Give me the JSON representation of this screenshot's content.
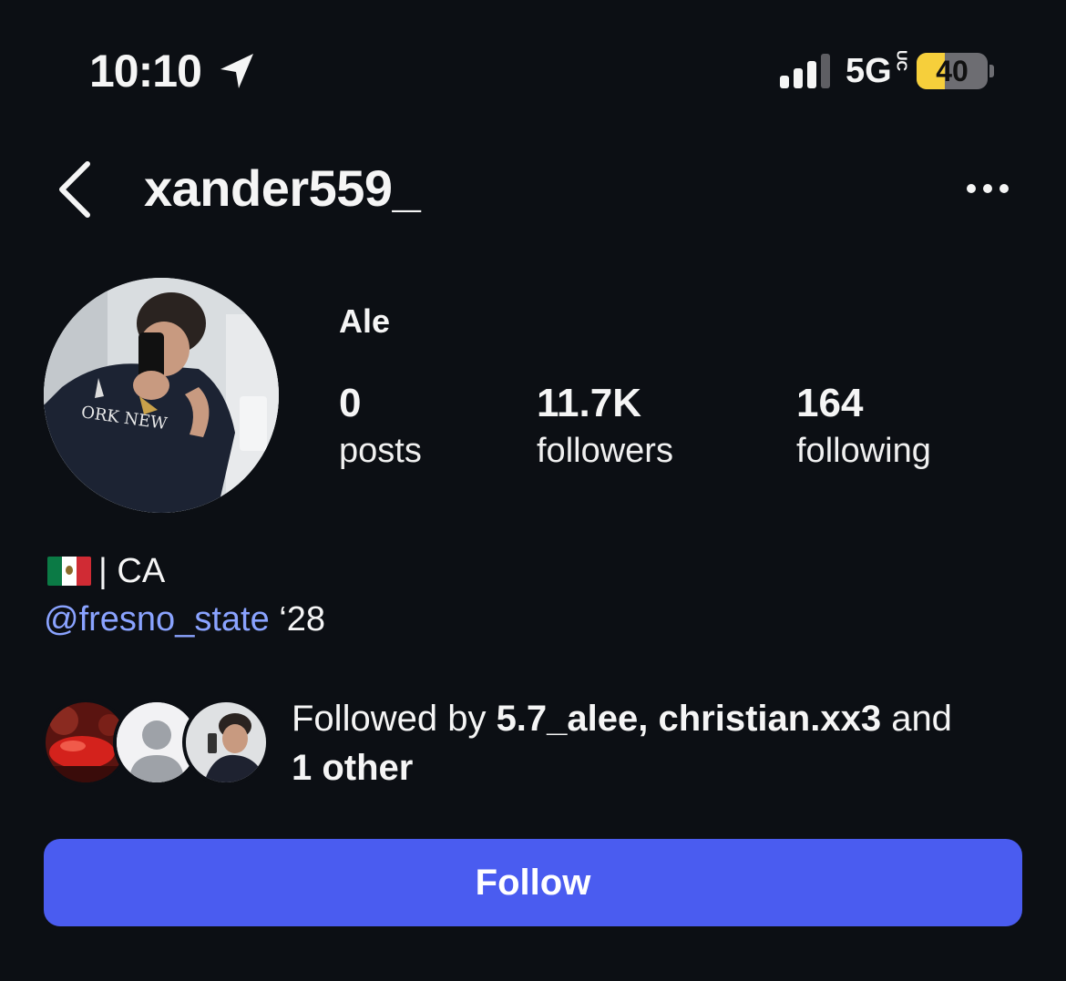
{
  "status_bar": {
    "time": "10:10",
    "network": "5G",
    "network_sup": "UC",
    "battery_level": 40,
    "battery_text": "40",
    "icons": [
      "location-arrow-icon",
      "signal-bars-icon",
      "battery-icon"
    ]
  },
  "header": {
    "username": "xander559_",
    "back_icon": "chevron-left-icon",
    "more_icon": "ellipsis-icon"
  },
  "profile": {
    "display_name": "Ale",
    "stats": [
      {
        "value": "0",
        "label": "posts"
      },
      {
        "value": "11.7K",
        "label": "followers"
      },
      {
        "value": "164",
        "label": "following"
      }
    ],
    "bio_line1": "| CA",
    "bio_flag": "mexico-flag-icon",
    "bio_mention": "@fresno_state",
    "bio_suffix": " ‘28"
  },
  "followed_by": {
    "prefix": "Followed by ",
    "user1": "5.7_alee",
    "sep": ", ",
    "user2": "christian.xx3",
    "and": " and",
    "other": "1 other"
  },
  "follow_button": {
    "label": "Follow"
  },
  "colors": {
    "background": "#0c0f14",
    "accent": "#4a5cf0",
    "link": "#8aa3ff",
    "battery_fill": "#f6cf3b"
  }
}
